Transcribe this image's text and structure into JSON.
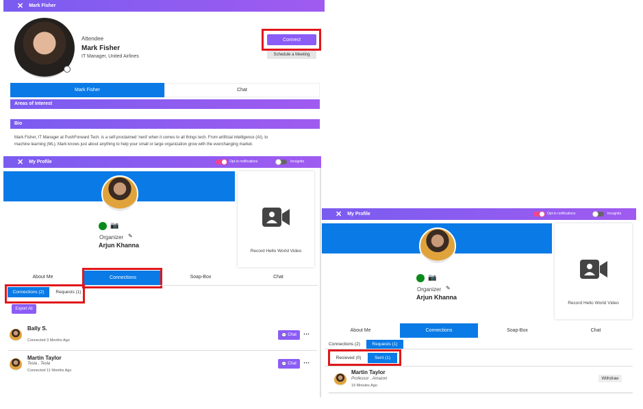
{
  "attendee_card": {
    "header_title": "Mark Fisher",
    "role": "Attendee",
    "name": "Mark Fisher",
    "subtitle": "IT Manager, United Airlines",
    "connect_label": "Connect",
    "schedule_label": "Schedule a Meeting",
    "tabs": [
      {
        "label": "Mark Fisher"
      },
      {
        "label": "Chat"
      }
    ],
    "areas_label": "Areas of Interest",
    "bio_label": "Bio",
    "bio_text_1": "Mark Fisher, IT Manager at PushForward Tech. is a self-proclaimed 'nerd' when it comes to all things tech. From artificial intelligence (AI), to",
    "bio_text_2": "machine learning (ML), Mark knows just about anything to help your small or large organization grow with the everchanging market."
  },
  "profile_left": {
    "header_title": "My Profile",
    "optin_label": "Opt-in notifications",
    "incognito_label": "Incognito",
    "role": "Organizer",
    "name": "Arjun Khanna",
    "video_label": "Record Hello World Video",
    "tabs": [
      {
        "label": "About Me"
      },
      {
        "label": "Connections"
      },
      {
        "label": "Soap-Box"
      },
      {
        "label": "Chat"
      }
    ],
    "subtabs": [
      {
        "label": "Connections (2)"
      },
      {
        "label": "Requests (1)"
      }
    ],
    "export_label": "Export All",
    "connections": [
      {
        "name": "Bally S.",
        "detail": "",
        "time": "Connected  3 Months Ago",
        "chat_label": "Chat"
      },
      {
        "name": "Martin Taylor",
        "detail": "Tesla ,  Tesla",
        "time": "Connected  11 Months Ago",
        "chat_label": "Chat"
      }
    ]
  },
  "profile_right": {
    "header_title": "My Profile",
    "optin_label": "Opt-in notifications",
    "incognito_label": "Incognito",
    "role": "Organizer",
    "name": "Arjun Khanna",
    "video_label": "Record Hello World Video",
    "tabs": [
      {
        "label": "About Me"
      },
      {
        "label": "Connections"
      },
      {
        "label": "Soap-Box"
      },
      {
        "label": "Chat"
      }
    ],
    "subtabs": [
      {
        "label": "Connections (2)"
      },
      {
        "label": "Requests (1)"
      }
    ],
    "req_tabs": [
      {
        "label": "Recieved  (0)"
      },
      {
        "label": "Sent  (1)"
      }
    ],
    "request": {
      "name": "Martin Taylor",
      "detail": "Professor ,  Amazon",
      "time": "19 Minutes Ago",
      "withdraw_label": "Withdraw"
    }
  },
  "colors": {
    "accent": "#8b5cf6",
    "blue": "#0a7ae6",
    "highlight": "#e0161b"
  }
}
